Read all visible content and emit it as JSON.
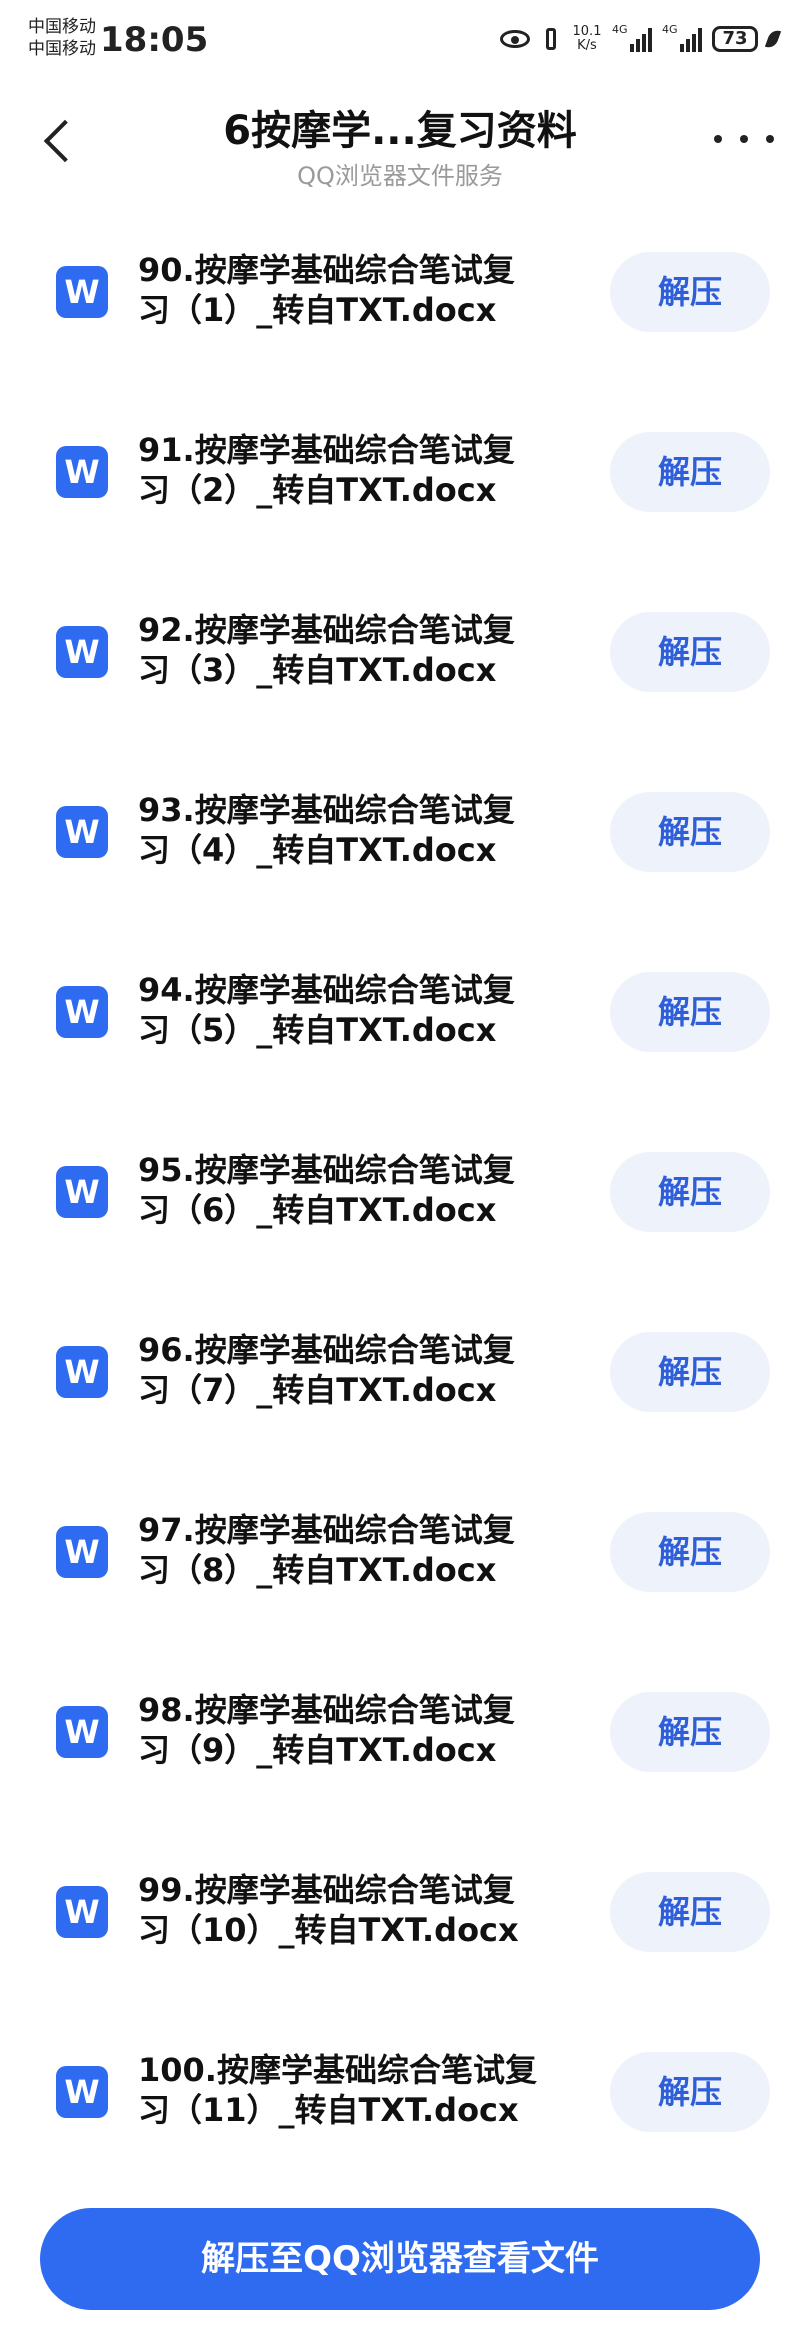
{
  "status_bar": {
    "carrier_1": "中国移动",
    "carrier_2": "中国移动",
    "time": "18:05",
    "net_speed_value": "10.1",
    "net_speed_unit": "K/s",
    "signal_1_tag": "4G",
    "signal_2_tag": "4G",
    "battery": "73",
    "icons": [
      "eye-icon",
      "vibrate-icon",
      "signal-icon",
      "battery-icon",
      "leaf-icon"
    ]
  },
  "header": {
    "title": "6按摩学...复习资料",
    "subtitle": "QQ浏览器文件服务",
    "back_icon": "chevron-left-icon",
    "more_icon": "more-dots-icon"
  },
  "files": [
    {
      "name_line1": "90.按摩学基础综合笔试复",
      "name_line2": "习（1）_转自TXT.docx",
      "icon_letter": "W",
      "action": "解压"
    },
    {
      "name_line1": "91.按摩学基础综合笔试复",
      "name_line2": "习（2）_转自TXT.docx",
      "icon_letter": "W",
      "action": "解压"
    },
    {
      "name_line1": "92.按摩学基础综合笔试复",
      "name_line2": "习（3）_转自TXT.docx",
      "icon_letter": "W",
      "action": "解压"
    },
    {
      "name_line1": "93.按摩学基础综合笔试复",
      "name_line2": "习（4）_转自TXT.docx",
      "icon_letter": "W",
      "action": "解压"
    },
    {
      "name_line1": "94.按摩学基础综合笔试复",
      "name_line2": "习（5）_转自TXT.docx",
      "icon_letter": "W",
      "action": "解压"
    },
    {
      "name_line1": "95.按摩学基础综合笔试复",
      "name_line2": "习（6）_转自TXT.docx",
      "icon_letter": "W",
      "action": "解压"
    },
    {
      "name_line1": "96.按摩学基础综合笔试复",
      "name_line2": "习（7）_转自TXT.docx",
      "icon_letter": "W",
      "action": "解压"
    },
    {
      "name_line1": "97.按摩学基础综合笔试复",
      "name_line2": "习（8）_转自TXT.docx",
      "icon_letter": "W",
      "action": "解压"
    },
    {
      "name_line1": "98.按摩学基础综合笔试复",
      "name_line2": "习（9）_转自TXT.docx",
      "icon_letter": "W",
      "action": "解压"
    },
    {
      "name_line1": "99.按摩学基础综合笔试复",
      "name_line2": "习（10）_转自TXT.docx",
      "icon_letter": "W",
      "action": "解压"
    },
    {
      "name_line1": "100.按摩学基础综合笔试复",
      "name_line2": "习（11）_转自TXT.docx",
      "icon_letter": "W",
      "action": "解压"
    }
  ],
  "cta": {
    "label": "解压至QQ浏览器查看文件"
  },
  "colors": {
    "accent": "#2f6bf0",
    "button_bg": "#eef2fb",
    "button_text": "#2f5fd8",
    "subtitle": "#9a9a9a"
  }
}
